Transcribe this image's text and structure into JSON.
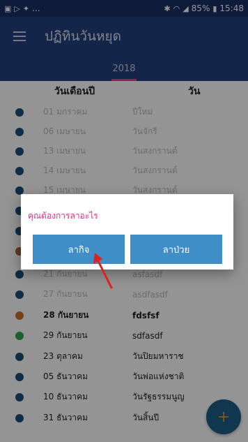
{
  "status_bar": {
    "left_text": "...",
    "battery": "85%",
    "time": "15:48"
  },
  "app_bar": {
    "title": "ปฏิทินวันหยุด"
  },
  "tabs": [
    {
      "label": "2018"
    }
  ],
  "table": {
    "headers": {
      "date": "วันเดือนปี",
      "day": "วัน"
    },
    "rows": [
      {
        "date": "01 มกราคม",
        "day": "ปีใหม่",
        "color": "#1a4f78"
      },
      {
        "date": "06 เมษายน",
        "day": "วันจักรี",
        "color": "#1a4f78"
      },
      {
        "date": "13 เมษายน",
        "day": "วันสงกรานต์",
        "color": "#1a4f78"
      },
      {
        "date": "14 เมษายน",
        "day": "วันสงกรานต์",
        "color": "#1a4f78"
      },
      {
        "date": "15 เมษายน",
        "day": "วันสงกรานต์",
        "color": "#1a4f78"
      },
      {
        "date": "",
        "day": "",
        "color": "#1a4f78"
      },
      {
        "date": "",
        "day": "",
        "color": "#1a4f78"
      },
      {
        "date": "",
        "day": "",
        "color": "#a36a2e"
      },
      {
        "date": "21 กันยายน",
        "day": "asfasdf",
        "color": "#1a4f78"
      },
      {
        "date": "27 กันยายน",
        "day": "asdfasdf",
        "color": "#1a4f78"
      },
      {
        "date": "28 กันยายน",
        "day": "fdsfsf",
        "color": "#c97326"
      },
      {
        "date": "29 กันยายน",
        "day": "sdfasdf",
        "color": "#2ea44f"
      },
      {
        "date": "23 ตุลาคม",
        "day": "วันปิยมหาราช",
        "color": "#1a4f78"
      },
      {
        "date": "05 ธันวาคม",
        "day": "วันพ่อแห่งชาติ",
        "color": "#1a4f78"
      },
      {
        "date": "10 ธันวาคม",
        "day": "วันรัฐธรรมนูญ",
        "color": "#1a4f78"
      },
      {
        "date": "31 ธันวาคม",
        "day": "วันสิ้นปี",
        "color": "#1a4f78"
      }
    ]
  },
  "dialog": {
    "title": "คุณต้องการลาอะไร",
    "button_left": "ลากิจ",
    "button_right": "ลาป่วย"
  },
  "fab": {
    "icon": "plus-icon",
    "glyph": "+"
  },
  "colors": {
    "app_bar": "#22407c",
    "accent": "#e83e8c",
    "button": "#3f8ec7",
    "annotation_arrow": "#e0201c"
  }
}
